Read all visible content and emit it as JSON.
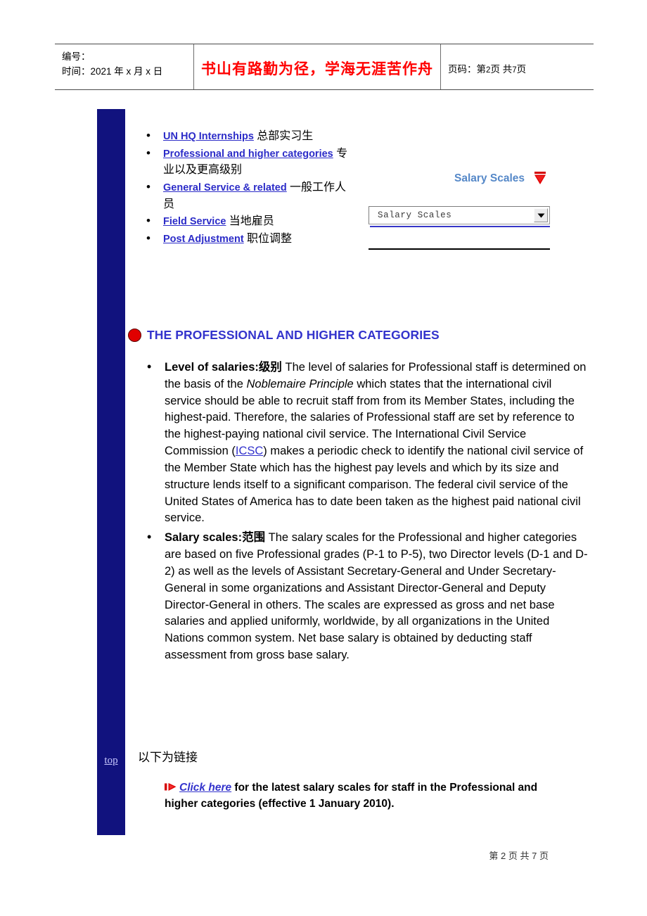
{
  "header": {
    "left": {
      "id_label": "编号：",
      "time_label": "时间：",
      "time_value": "2021 年 x 月 x 日"
    },
    "motto": "书山有路勤为径，学海无涯苦作舟",
    "right": {
      "page_label": "页码：",
      "page_current_prefix": "第",
      "page_current": "2",
      "page_unit": "页",
      "page_total_prefix": "共",
      "page_total": "7",
      "page_total_unit": "页"
    }
  },
  "sidebar": {
    "top_link_label": "top"
  },
  "nav": {
    "items": [
      {
        "link": "UN HQ Internships",
        "cn": "总部实习生"
      },
      {
        "link": "Professional and higher categories",
        "cn": "专业以及更高级别"
      },
      {
        "link": "General Service & related",
        "cn": "一般工作人员"
      },
      {
        "link": "Field Service",
        "cn": "当地雇员"
      },
      {
        "link": "Post Adjustment",
        "cn": "职位调整"
      }
    ]
  },
  "salary_widget": {
    "title": "Salary Scales",
    "title_color": "#5588c8",
    "funnel_icon": "red-funnel-icon",
    "select": {
      "value": "Salary Scales",
      "options": [
        "Salary Scales"
      ]
    }
  },
  "section": {
    "bullet_icon": "red-circle-icon",
    "heading": "THE PROFESSIONAL AND HIGHER CATEGORIES",
    "heading_color": "#3333cc"
  },
  "body": {
    "bullets": [
      {
        "lead": "Level of salaries:",
        "lead_cn": "级别",
        "text_before_italic": "  The level of salaries for Professional staff is determined on the basis of the ",
        "italic": "Noblemaire Principle",
        "text_after_italic": " which states that the international civil service should be able to recruit staff from from its Member States, including the highest-paid. Therefore, the salaries of Professional staff are set by reference to the highest-paying national civil service. The International Civil Service Commission (",
        "link": "ICSC",
        "text_tail": ") makes a periodic check to identify the national civil service of the Member State which has the highest pay levels and which by its size and structure lends itself to a significant comparison. The federal civil service of the United States of America has to date been taken as the highest paid national civil service."
      },
      {
        "lead": "Salary scales:",
        "lead_cn": "范围",
        "text": "  The salary scales for the Professional and higher categories are based on five Professional grades (P-1 to P-5), two Director levels (D-1 and D-2) as well as the levels of Assistant Secretary-General and Under Secretary-General in some organizations and Assistant Director-General and Deputy Director-General in others. The scales are expressed as gross and net base salaries and applied uniformly, worldwide, by all organizations in the United Nations common system. Net base salary is obtained by deducting staff assessment from gross base salary."
      }
    ]
  },
  "footer_block": {
    "links_intro": "以下为链接",
    "play_icon": "red-play-triangle-icon",
    "click_link": "Click here",
    "click_text": " for the latest salary scales for staff in the Professional and higher categories (effective 1 January 2010)."
  },
  "page_footer": {
    "prefix": "第",
    "current": "2",
    "unit": "页",
    "total_prefix": "共",
    "total": "7",
    "total_unit": "页"
  }
}
